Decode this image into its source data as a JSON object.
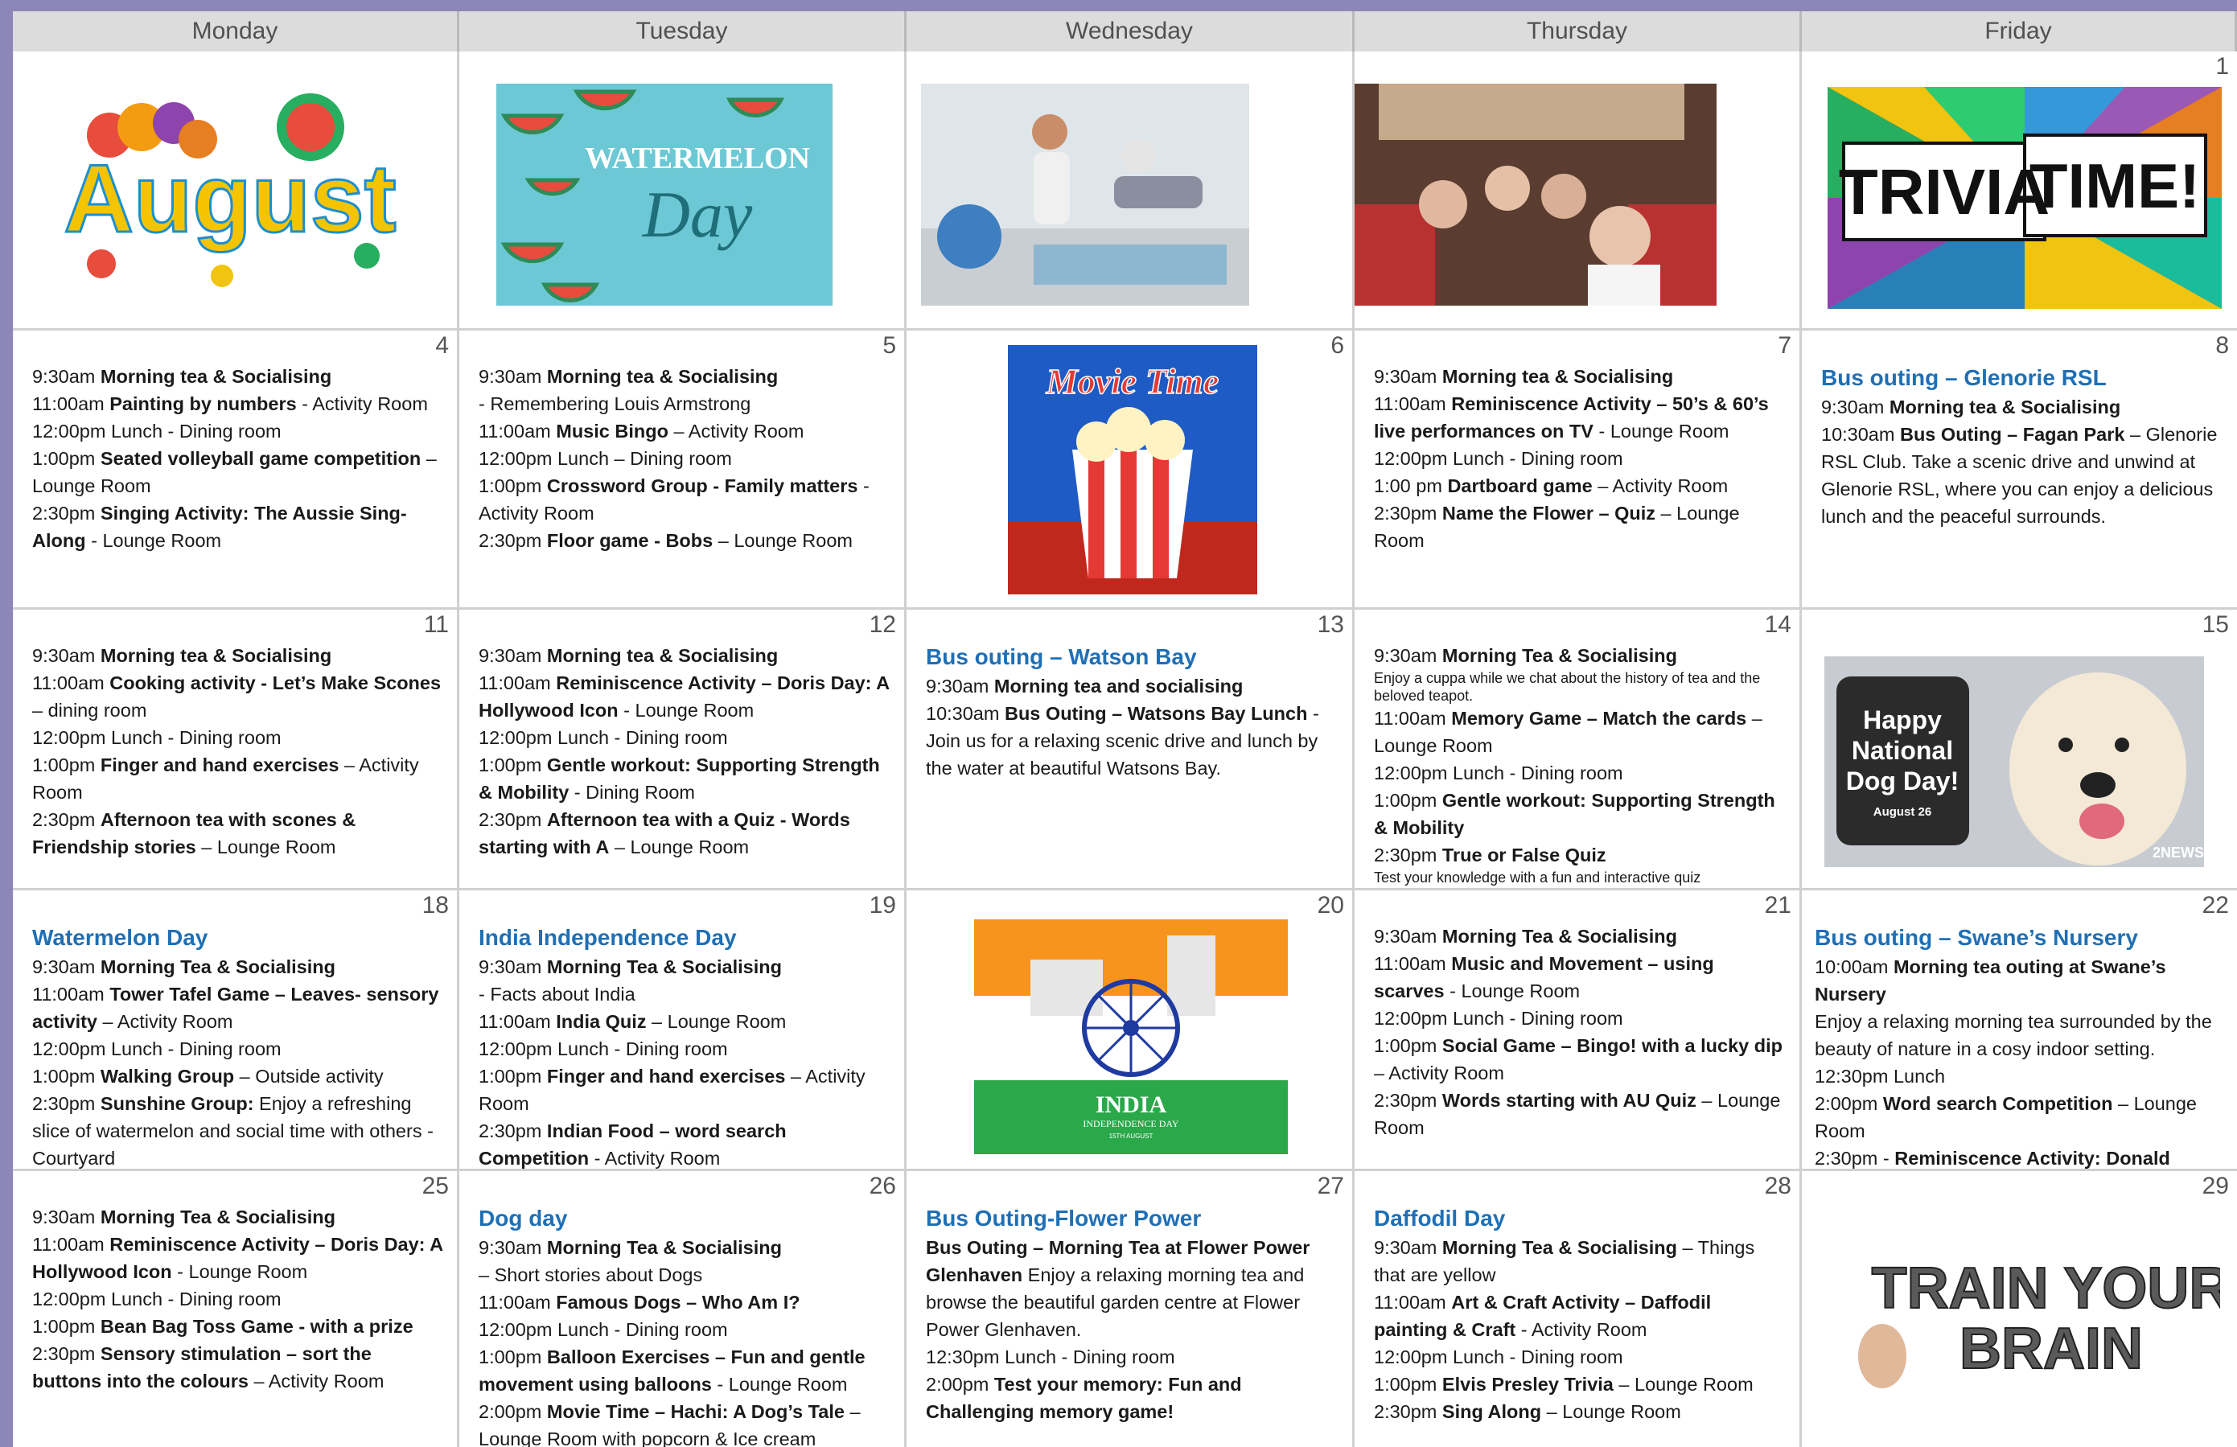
{
  "headers": {
    "mon": "Monday",
    "tue": "Tuesday",
    "wed": "Wednesday",
    "thu": "Thursday",
    "fri": "Friday"
  },
  "images": {
    "august": "August",
    "watermelon_line1": "WATERMELON",
    "watermelon_line2": "Day",
    "trivia_word1": "TRIVIA",
    "trivia_word2": "TIME!",
    "movie": "Movie Time",
    "dog_line1": "Happy",
    "dog_line2": "National",
    "dog_line3": "Dog Day!",
    "dog_date": "August 26",
    "dog_logo": "2NEWS",
    "india_line1": "INDIA",
    "india_line2": "INDEPENDENCE DAY",
    "india_line3": "15TH AUGUST",
    "brain_line1": "TRAIN YOUR",
    "brain_line2": "BRAIN"
  },
  "days": {
    "d1": {
      "num": "1"
    },
    "d4": {
      "num": "4",
      "lines": [
        [
          "9:30am ",
          "Morning tea & Socialising",
          ""
        ],
        [
          "11:00am ",
          "Painting by numbers",
          " - Activity Room"
        ],
        [
          "12:00pm Lunch - Dining room",
          "",
          ""
        ],
        [
          "1:00pm ",
          "Seated volleyball game competition",
          " – Lounge Room"
        ],
        [
          "2:30pm ",
          "Singing Activity: The Aussie Sing-Along",
          " - Lounge Room"
        ]
      ]
    },
    "d5": {
      "num": "5",
      "lines": [
        [
          "9:30am ",
          "Morning tea & Socialising",
          ""
        ],
        [
          "- Remembering Louis Armstrong",
          "",
          ""
        ],
        [
          "11:00am ",
          "Music Bingo",
          " – Activity Room"
        ],
        [
          "12:00pm Lunch – Dining room",
          "",
          ""
        ],
        [
          "1:00pm ",
          "Crossword Group - Family matters",
          " - Activity Room"
        ],
        [
          "2:30pm ",
          "Floor game - Bobs",
          " – Lounge Room"
        ]
      ]
    },
    "d6": {
      "num": "6"
    },
    "d7": {
      "num": "7",
      "lines": [
        [
          "9:30am ",
          "Morning tea & Socialising",
          ""
        ],
        [
          "11:00am ",
          "Reminiscence Activity – 50’s & 60’s live performances on TV",
          " - Lounge Room"
        ],
        [
          "12:00pm Lunch - Dining room",
          "",
          ""
        ],
        [
          "1:00 pm ",
          "Dartboard game",
          " – Activity Room"
        ],
        [
          "2:30pm ",
          "Name the Flower – Quiz",
          " – Lounge Room"
        ]
      ]
    },
    "d8": {
      "num": "8",
      "title": "Bus outing – Glenorie RSL",
      "lines": [
        [
          "9:30am ",
          "Morning tea & Socialising",
          ""
        ],
        [
          "10:30am ",
          "Bus Outing – Fagan Park",
          " – Glenorie RSL Club. Take a scenic drive and unwind at Glenorie RSL, where you can enjoy a delicious lunch and the peaceful surrounds."
        ]
      ]
    },
    "d11": {
      "num": "11",
      "lines": [
        [
          "9:30am ",
          "Morning tea & Socialising",
          ""
        ],
        [
          "11:00am ",
          "Cooking activity - Let’s Make Scones",
          " – dining room"
        ],
        [
          "12:00pm Lunch - Dining room",
          "",
          ""
        ],
        [
          "1:00pm ",
          "Finger and hand exercises",
          " – Activity Room"
        ],
        [
          "2:30pm ",
          "Afternoon tea with scones & Friendship stories",
          " – Lounge Room"
        ]
      ]
    },
    "d12": {
      "num": "12",
      "lines": [
        [
          "9:30am ",
          "Morning tea & Socialising",
          ""
        ],
        [
          "11:00am ",
          "Reminiscence Activity – Doris Day: A Hollywood Icon",
          " - Lounge Room"
        ],
        [
          "12:00pm Lunch - Dining room",
          "",
          ""
        ],
        [
          "1:00pm ",
          "Gentle workout: Supporting Strength & Mobility",
          " - Dining Room"
        ],
        [
          "2:30pm ",
          "Afternoon tea with a Quiz - Words starting with A",
          " – Lounge Room"
        ]
      ]
    },
    "d13": {
      "num": "13",
      "title": "Bus outing – Watson Bay",
      "lines": [
        [
          "9:30am ",
          "Morning tea and socialising",
          ""
        ],
        [
          "10:30am ",
          "Bus Outing – Watsons Bay Lunch",
          " - Join us for a relaxing scenic drive and lunch by the water at beautiful Watsons Bay."
        ]
      ]
    },
    "d14": {
      "num": "14",
      "lines": [
        [
          "9:30am ",
          "Morning Tea & Socialising",
          ""
        ],
        [
          "",
          "",
          "",
          "Enjoy a cuppa while we chat about the history of tea and the beloved teapot."
        ],
        [
          "11:00am ",
          "Memory Game – Match the cards",
          " – Lounge Room"
        ],
        [
          "12:00pm Lunch - Dining room",
          "",
          ""
        ],
        [
          "1:00pm ",
          "Gentle workout: Supporting Strength & Mobility",
          ""
        ],
        [
          "2:30pm ",
          "True or False Quiz",
          ""
        ],
        [
          "",
          "",
          "",
          "Test your knowledge with a fun and interactive quiz"
        ]
      ]
    },
    "d15": {
      "num": "15"
    },
    "d18": {
      "num": "18",
      "title": "Watermelon Day",
      "lines": [
        [
          "9:30am ",
          "Morning Tea & Socialising",
          ""
        ],
        [
          "11:00am ",
          "Tower Tafel Game – Leaves- sensory activity",
          " – Activity Room"
        ],
        [
          "12:00pm Lunch - Dining room",
          "",
          ""
        ],
        [
          "1:00pm ",
          "Walking Group",
          " – Outside activity"
        ],
        [
          "2:30pm ",
          "Sunshine Group:",
          " Enjoy a refreshing slice of watermelon and social time with others - Courtyard"
        ]
      ]
    },
    "d19": {
      "num": "19",
      "title": "India Independence Day",
      "lines": [
        [
          "9:30am ",
          "Morning Tea & Socialising",
          ""
        ],
        [
          "- Facts about India",
          "",
          ""
        ],
        [
          "11:00am ",
          "India Quiz",
          " – Lounge Room"
        ],
        [
          "12:00pm Lunch - Dining room",
          "",
          ""
        ],
        [
          "1:00pm ",
          "Finger and hand exercises",
          " – Activity Room"
        ],
        [
          "2:30pm ",
          "Indian Food – word search Competition",
          " - Activity Room"
        ]
      ]
    },
    "d20": {
      "num": "20"
    },
    "d21": {
      "num": "21",
      "lines": [
        [
          "9:30am ",
          "Morning Tea & Socialising",
          ""
        ],
        [
          "11:00am ",
          "Music and Movement – using scarves",
          " - Lounge Room"
        ],
        [
          "12:00pm Lunch - Dining room",
          "",
          ""
        ],
        [
          "1:00pm ",
          "Social Game – Bingo! with a lucky dip",
          " – Activity Room"
        ],
        [
          "2:30pm ",
          "Words starting with AU Quiz",
          " – Lounge Room"
        ]
      ]
    },
    "d22": {
      "num": "22",
      "title": "Bus outing – Swane’s Nursery",
      "lines": [
        [
          "10:00am ",
          "Morning tea outing at Swane’s Nursery",
          ""
        ],
        [
          "Enjoy a relaxing morning tea surrounded by the beauty of nature in a cosy indoor setting.",
          "",
          ""
        ],
        [
          "12:30pm Lunch",
          "",
          ""
        ],
        [
          "2:00pm ",
          "Word search Competition",
          " – Lounge Room"
        ],
        [
          "2:30pm - ",
          "Reminiscence Activity: Donald Bradman Biography",
          " – Lounge Room"
        ]
      ]
    },
    "d25": {
      "num": "25",
      "lines": [
        [
          "9:30am ",
          "Morning Tea & Socialising",
          ""
        ],
        [
          "11:00am ",
          "Reminiscence Activity – Doris Day: A Hollywood Icon",
          " - Lounge Room"
        ],
        [
          "12:00pm Lunch - Dining room",
          "",
          ""
        ],
        [
          "1:00pm ",
          "Bean Bag Toss Game - with a prize",
          ""
        ],
        [
          "2:30pm ",
          "Sensory stimulation – sort the buttons into the colours",
          " – Activity Room"
        ]
      ]
    },
    "d26": {
      "num": "26",
      "title": "Dog day",
      "lines": [
        [
          "9:30am ",
          "Morning Tea & Socialising",
          ""
        ],
        [
          "– Short stories about Dogs",
          "",
          ""
        ],
        [
          "11:00am ",
          "Famous Dogs – Who Am I?",
          ""
        ],
        [
          "12:00pm Lunch - Dining room",
          "",
          ""
        ],
        [
          "1:00pm ",
          "Balloon Exercises – Fun and gentle movement using balloons",
          " - Lounge Room"
        ],
        [
          "2:00pm ",
          "Movie Time – Hachi: A Dog’s Tale",
          " – Lounge Room with popcorn & Ice cream"
        ]
      ]
    },
    "d27": {
      "num": "27",
      "title": "Bus Outing-Flower Power",
      "lines": [
        [
          "",
          "Bus Outing – Morning Tea at Flower Power Glenhaven",
          " Enjoy a relaxing morning tea and browse the beautiful garden centre at Flower Power Glenhaven."
        ],
        [
          "12:30pm Lunch - Dining room",
          "",
          ""
        ],
        [
          "2:00pm ",
          "Test your memory: Fun and Challenging memory game!",
          ""
        ]
      ]
    },
    "d28": {
      "num": "28",
      "title": "Daffodil Day",
      "lines": [
        [
          "9:30am ",
          "Morning Tea & Socialising",
          " – Things that are yellow"
        ],
        [
          "11:00am ",
          "Art & Craft Activity – Daffodil painting & Craft",
          " - Activity Room"
        ],
        [
          "12:00pm Lunch - Dining room",
          "",
          ""
        ],
        [
          "1:00pm ",
          "Elvis Presley Trivia",
          " – Lounge Room"
        ],
        [
          "2:30pm ",
          "Sing Along",
          " – Lounge Room"
        ]
      ]
    },
    "d29": {
      "num": "29"
    }
  }
}
